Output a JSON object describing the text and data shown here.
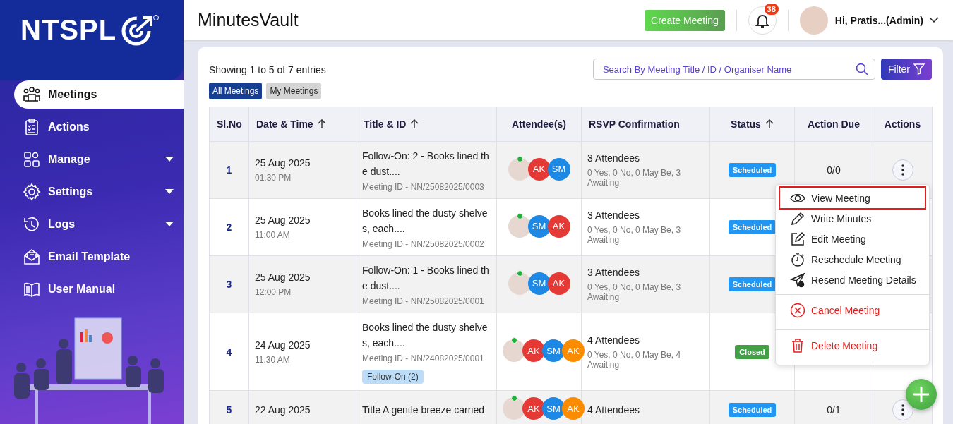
{
  "sidebar": {
    "logo": "NTSPL",
    "items": [
      {
        "label": "Meetings",
        "kind": "link",
        "selected": true
      },
      {
        "label": "Actions",
        "kind": "link",
        "selected": false
      },
      {
        "label": "Manage",
        "kind": "dropdown",
        "selected": false
      },
      {
        "label": "Settings",
        "kind": "dropdown",
        "selected": false
      },
      {
        "label": "Logs",
        "kind": "dropdown",
        "selected": false
      },
      {
        "label": "Email Template",
        "kind": "link",
        "selected": false
      },
      {
        "label": "User Manual",
        "kind": "link",
        "selected": false
      }
    ]
  },
  "header": {
    "title": "MinutesVault",
    "create_button": "Create Meeting",
    "notification_count": "38",
    "user": "Hi, Pratis...(Admin)"
  },
  "summary": "Showing 1 to 5 of 7 entries",
  "tabs": [
    {
      "label": "All Meetings",
      "selected": true
    },
    {
      "label": "My Meetings",
      "selected": false
    }
  ],
  "search": {
    "placeholder": "Search By Meeting Title / ID / Organiser Name"
  },
  "filter_button": "Filter",
  "table": {
    "columns": [
      {
        "label": "Sl.No",
        "sortable": false
      },
      {
        "label": "Date & Time",
        "sortable": true
      },
      {
        "label": "Title & ID",
        "sortable": true
      },
      {
        "label": "Attendee(s)",
        "sortable": false
      },
      {
        "label": "RSVP Confirmation",
        "sortable": false
      },
      {
        "label": "Status",
        "sortable": true
      },
      {
        "label": "Action Due",
        "sortable": false
      },
      {
        "label": "Actions",
        "sortable": false
      }
    ],
    "rows": [
      {
        "sl": "1",
        "date": "25 Aug 2025",
        "time": "01:30 PM",
        "title": "Follow-On: 2 - Books lined the dust....",
        "meeting_id": "Meeting ID - NN/25082025/0003",
        "attendees": [
          {
            "initials": "AK",
            "color": "#e53935"
          },
          {
            "initials": "SM",
            "color": "#1e88e5"
          }
        ],
        "rsvp": "3 Attendees",
        "rsvp_detail": "0 Yes, 0 No, 0 May Be, 3 Awaiting",
        "status": "Scheduled",
        "kind": "scheduled",
        "action_due": "0/0"
      },
      {
        "sl": "2",
        "date": "25 Aug 2025",
        "time": "11:00 AM",
        "title": "Books lined the dusty shelves, each....",
        "meeting_id": "Meeting ID - NN/25082025/0002",
        "attendees": [
          {
            "initials": "SM",
            "color": "#1e88e5"
          },
          {
            "initials": "AK",
            "color": "#e53935"
          }
        ],
        "rsvp": "3 Attendees",
        "rsvp_detail": "0 Yes, 0 No, 0 May Be, 3 Awaiting",
        "status": "Scheduled",
        "kind": "scheduled"
      },
      {
        "sl": "3",
        "date": "25 Aug 2025",
        "time": "12:00 PM",
        "title": "Follow-On: 1 - Books lined the dust....",
        "meeting_id": "Meeting ID - NN/25082025/0001",
        "attendees": [
          {
            "initials": "SM",
            "color": "#1e88e5"
          },
          {
            "initials": "AK",
            "color": "#e53935"
          }
        ],
        "rsvp": "3 Attendees",
        "rsvp_detail": "0 Yes, 0 No, 0 May Be, 3 Awaiting",
        "status": "Scheduled",
        "kind": "scheduled"
      },
      {
        "sl": "4",
        "date": "24 Aug 2025",
        "time": "11:30 AM",
        "title": "Books lined the dusty shelves, each....",
        "meeting_id": "Meeting ID - NN/24082025/0001",
        "tag": "Follow-On (2)",
        "attendees": [
          {
            "initials": "AK",
            "color": "#e53935"
          },
          {
            "initials": "SM",
            "color": "#1e88e5"
          },
          {
            "initials": "AK",
            "color": "#fb8c00"
          }
        ],
        "rsvp": "4 Attendees",
        "rsvp_detail": "0 Yes, 0 No, 0 May Be, 4 Awaiting",
        "status": "Closed",
        "kind": "closed"
      },
      {
        "sl": "5",
        "date": "22 Aug 2025",
        "title": "Title A gentle breeze carried",
        "attendees": [
          {
            "initials": "AK",
            "color": "#e53935"
          },
          {
            "initials": "SM",
            "color": "#1e88e5"
          },
          {
            "initials": "AK",
            "color": "#fb8c00"
          }
        ],
        "rsvp": "4 Attendees",
        "status": "Scheduled",
        "kind": "scheduled",
        "action_due": "0/1"
      }
    ]
  },
  "action_menu": {
    "items": [
      {
        "label": "View Meeting",
        "kind": "normal",
        "highlighted": true
      },
      {
        "label": "Write Minutes",
        "kind": "normal",
        "highlighted": false
      },
      {
        "label": "Edit Meeting",
        "kind": "normal",
        "highlighted": false
      },
      {
        "label": "Reschedule Meeting",
        "kind": "normal",
        "highlighted": false
      },
      {
        "label": "Resend Meeting Details",
        "kind": "normal",
        "highlighted": false
      },
      {
        "label": "Cancel Meeting",
        "kind": "danger",
        "highlighted": false
      },
      {
        "label": "Delete Meeting",
        "kind": "danger",
        "highlighted": false
      }
    ]
  }
}
